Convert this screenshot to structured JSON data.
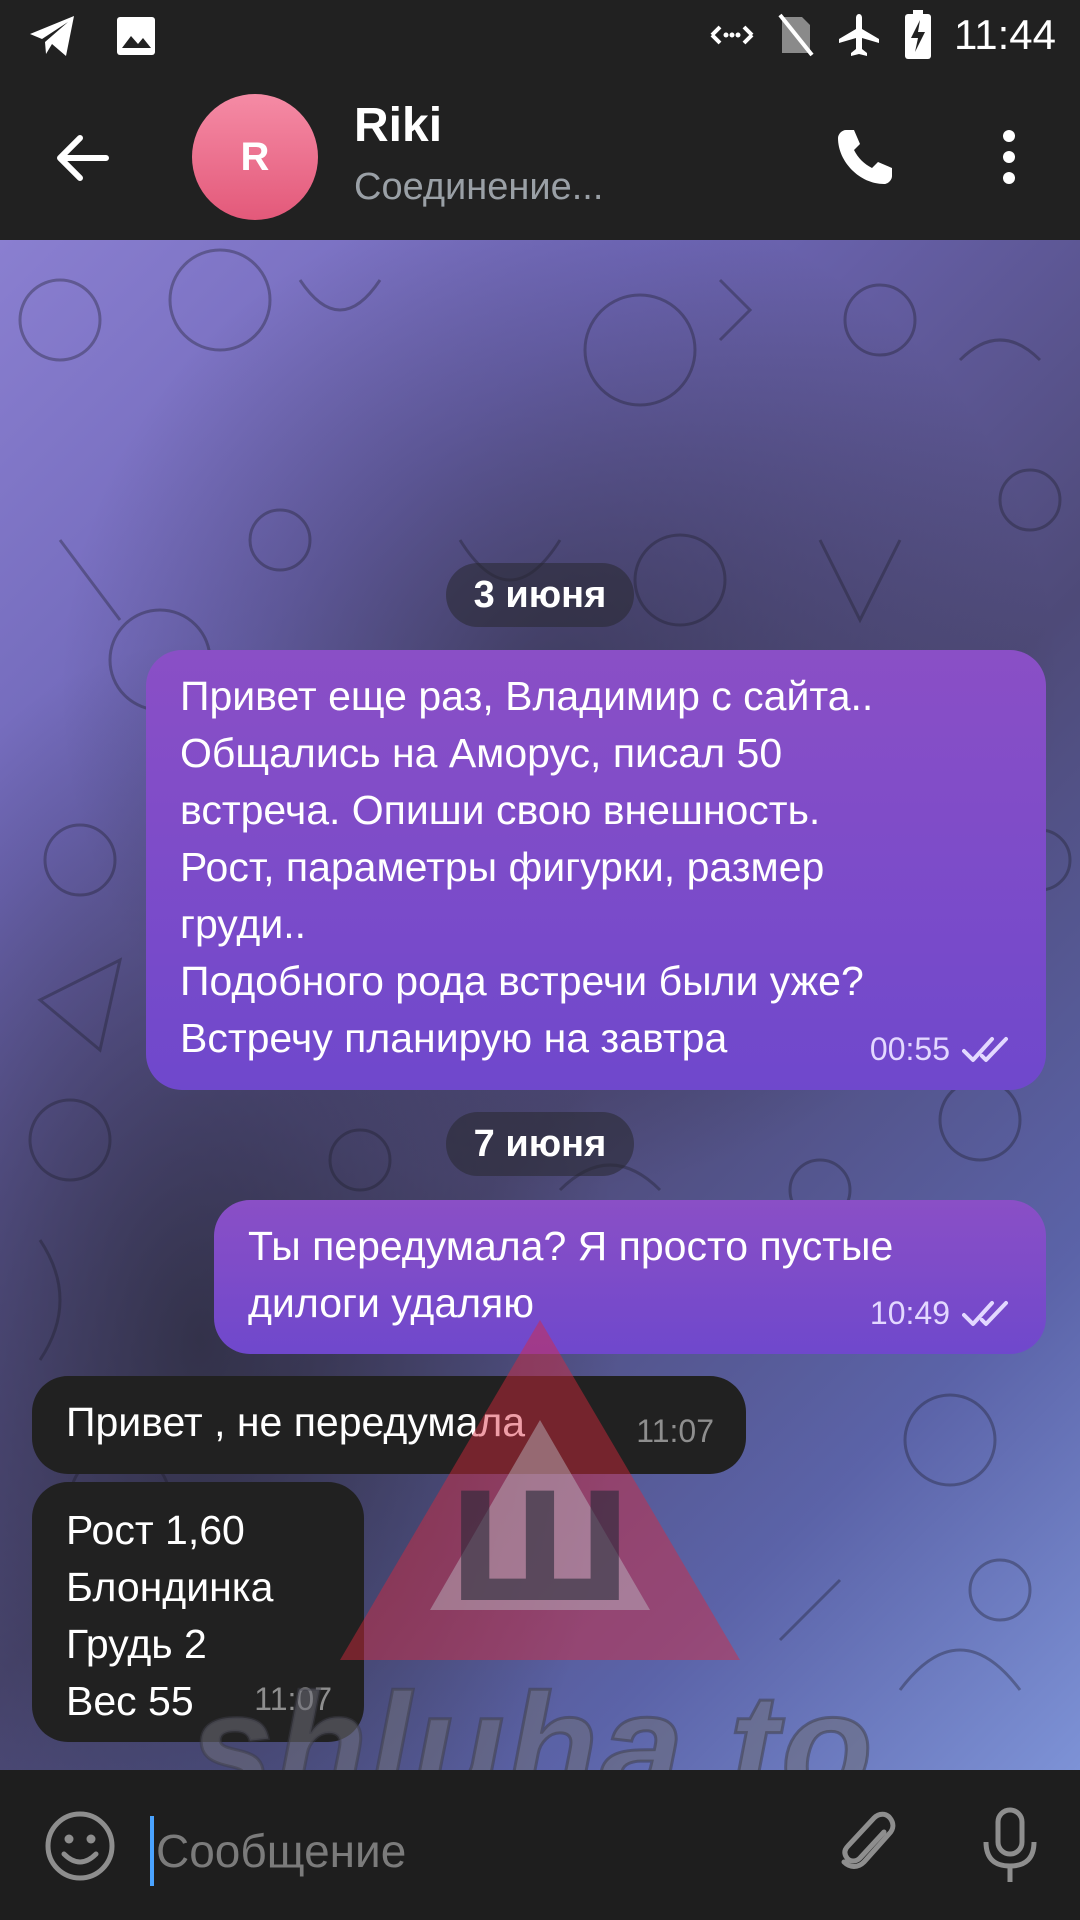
{
  "status_bar": {
    "time": "11:44",
    "left_icons": [
      "telegram-icon",
      "image-icon"
    ],
    "right_icons": [
      "data-transfer-icon",
      "no-sim-icon",
      "airplane-icon",
      "battery-charging-icon"
    ]
  },
  "header": {
    "avatar_letter": "R",
    "name": "Riki",
    "status": "Соединение..."
  },
  "chat": {
    "messages": [
      {
        "type": "date",
        "text": "3 июня"
      },
      {
        "type": "outgoing",
        "text": "Привет еще раз, Владимир с сайта..\nОбщались на Аморус, писал 50\nвстреча. Опиши свою внешность.\nРост, параметры фигурки, размер\nгруди..\nПодобного рода встречи были уже?\nВстречу планирую на завтра",
        "time": "00:55",
        "status": "read"
      },
      {
        "type": "date",
        "text": "7 июня"
      },
      {
        "type": "outgoing",
        "text": "Ты передумала? Я просто пустые\nдилоги удаляю",
        "time": "10:49",
        "status": "read"
      },
      {
        "type": "incoming",
        "text": "Привет , не передумала",
        "time": "11:07"
      },
      {
        "type": "incoming",
        "text": "Рост 1,60\nБлондинка\nГрудь 2\nВес 55",
        "time": "11:07"
      }
    ]
  },
  "watermark": {
    "letter": "Ш",
    "text": "shluha.to"
  },
  "input": {
    "placeholder": "Сообщение",
    "value": ""
  },
  "colors": {
    "outgoing_bubble": "#7a4cc8",
    "incoming_bubble": "#212121",
    "header": "#212121",
    "avatar": "#ec6f8c",
    "cursor": "#4aa3ff"
  }
}
